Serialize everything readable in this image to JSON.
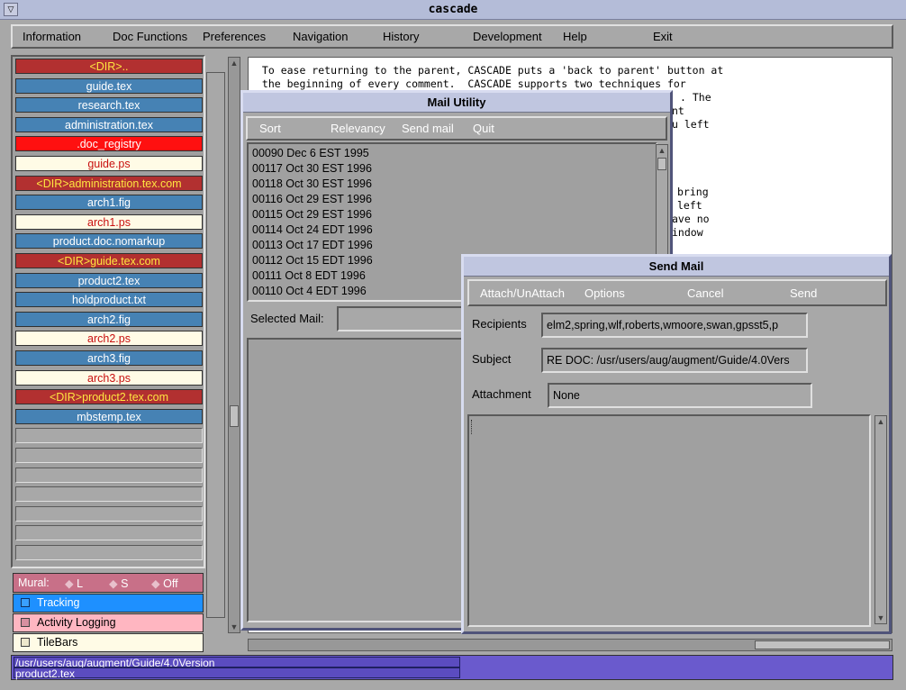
{
  "window": {
    "title": "cascade"
  },
  "menubar": {
    "items": [
      "Information",
      "Doc Functions",
      "Preferences",
      "Navigation",
      "History",
      "Development",
      "Help",
      "Exit"
    ]
  },
  "files": [
    {
      "label": "<DIR>..",
      "kind": "dir"
    },
    {
      "label": "guide.tex",
      "kind": "tex"
    },
    {
      "label": "research.tex",
      "kind": "tex"
    },
    {
      "label": "administration.tex",
      "kind": "tex"
    },
    {
      "label": ".doc_registry",
      "kind": "registry"
    },
    {
      "label": "guide.ps",
      "kind": "ps"
    },
    {
      "label": "<DIR>administration.tex.com",
      "kind": "dir"
    },
    {
      "label": "arch1.fig",
      "kind": "tex"
    },
    {
      "label": "arch1.ps",
      "kind": "ps"
    },
    {
      "label": "product.doc.nomarkup",
      "kind": "tex"
    },
    {
      "label": "<DIR>guide.tex.com",
      "kind": "dir"
    },
    {
      "label": "product2.tex",
      "kind": "tex"
    },
    {
      "label": "holdproduct.txt",
      "kind": "tex"
    },
    {
      "label": "arch2.fig",
      "kind": "tex"
    },
    {
      "label": "arch2.ps",
      "kind": "ps"
    },
    {
      "label": "arch3.fig",
      "kind": "tex"
    },
    {
      "label": "arch3.ps",
      "kind": "ps"
    },
    {
      "label": "<DIR>product2.tex.com",
      "kind": "dir"
    },
    {
      "label": "mbstemp.tex",
      "kind": "tex"
    }
  ],
  "empty_slots": 7,
  "mural": {
    "label": "Mural:",
    "options": [
      "L",
      "S",
      "Off"
    ]
  },
  "options": [
    {
      "label": "Tracking",
      "color": "#1e90ff",
      "text_color": "#ffffff"
    },
    {
      "label": "Activity Logging",
      "color": "#ffb6c1",
      "text_color": "#000000"
    },
    {
      "label": "TileBars",
      "color": "#fffbe6",
      "text_color": "#000000"
    }
  ],
  "status": {
    "path": "/usr/users/aug/augment/Guide/4.0Version",
    "file": "product2.tex"
  },
  "document": {
    "lines": [
      " To ease returning to the parent, CASCADE puts a 'back to parent' button at",
      " the beginning of every comment.  CASCADE supports two techniques for"
    ],
    "fragments": [
      ". The",
      "nt",
      "u left",
      "bring",
      "left",
      "ave no",
      "indow"
    ]
  },
  "mail_utility": {
    "title": "Mail Utility",
    "menu": [
      "Sort",
      "Relevancy",
      "Send mail",
      "Quit"
    ],
    "messages": [
      "00090 Dec 6 EST 1995",
      "00117 Oct 30 EST 1996",
      "00118 Oct 30 EST 1996",
      "00116 Oct 29 EST 1996",
      "00115 Oct 29 EST 1996",
      "00114 Oct 24 EDT 1996",
      "00113 Oct 17 EDT 1996",
      "00112 Oct 15 EDT 1996",
      "00111 Oct 8 EDT 1996",
      "00110 Oct 4 EDT 1996"
    ],
    "selected_label": "Selected Mail:",
    "selected_value": ""
  },
  "send_mail": {
    "title": "Send Mail",
    "menu": [
      "Attach/UnAttach",
      "Options",
      "Cancel",
      "Send"
    ],
    "recipients_label": "Recipients",
    "recipients_value": "elm2,spring,wlf,roberts,wmoore,swan,gpsst5,p",
    "subject_label": "Subject",
    "subject_value": "RE DOC: /usr/users/aug/augment/Guide/4.0Vers",
    "attachment_label": "Attachment",
    "attachment_value": "None",
    "body": ""
  }
}
